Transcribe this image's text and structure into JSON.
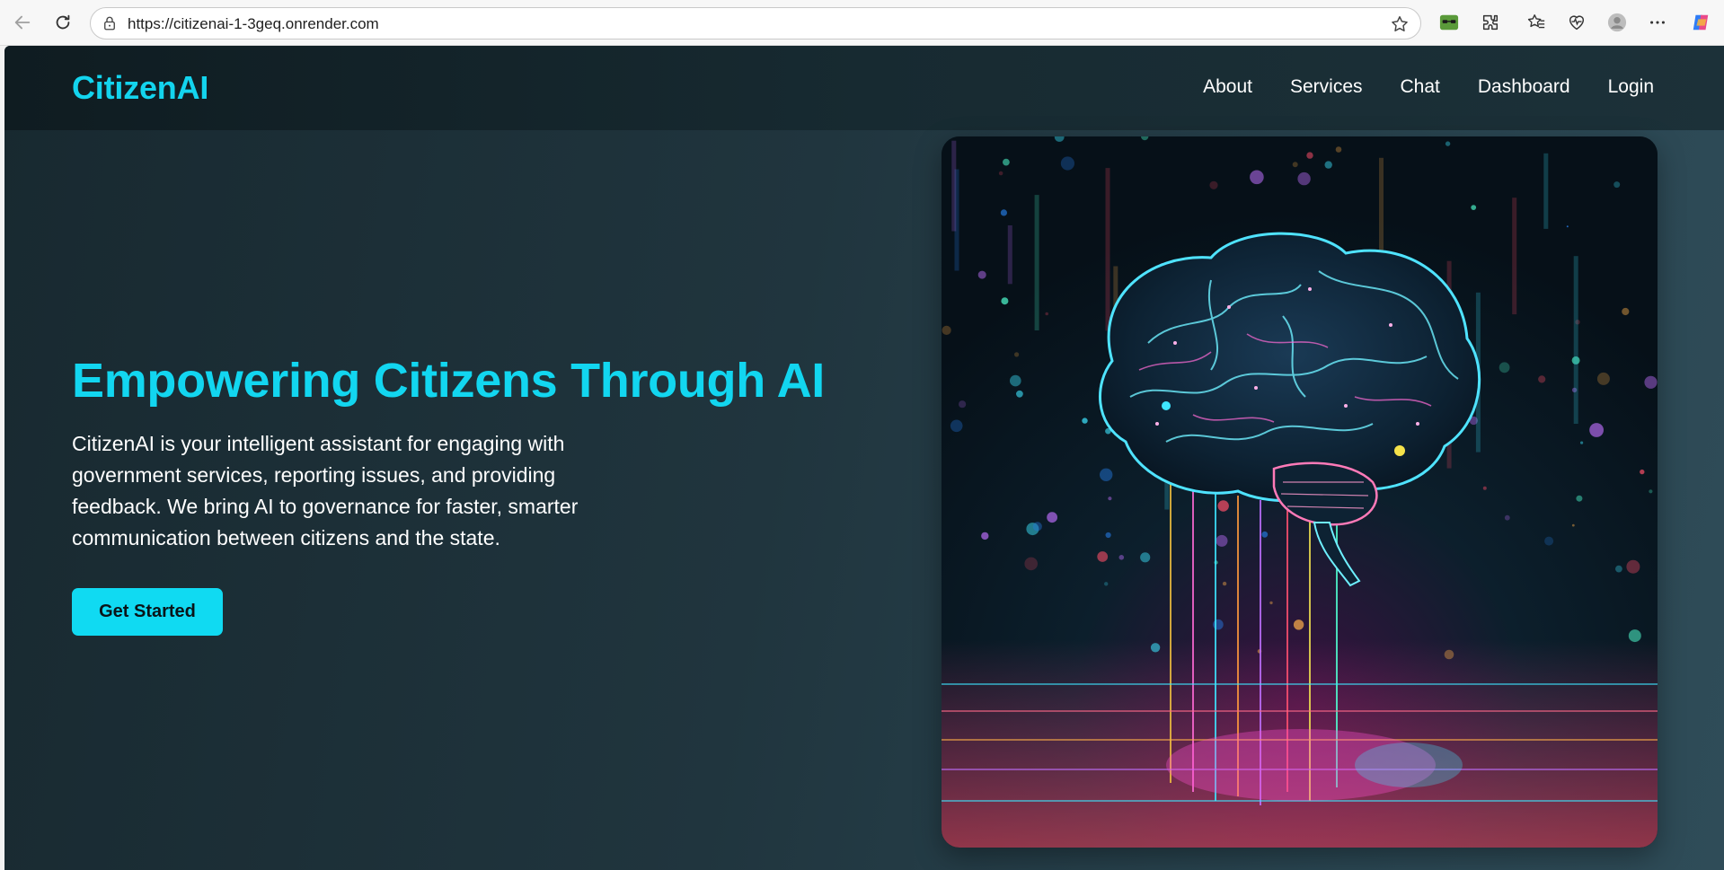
{
  "browser": {
    "url": "https://citizenai-1-3geq.onrender.com",
    "icons": [
      "back-icon",
      "reload-icon",
      "lock-icon",
      "star-icon",
      "glasses-extension-icon",
      "extensions-icon",
      "favorites-icon",
      "health-icon",
      "profile-icon",
      "more-icon",
      "copilot-icon"
    ]
  },
  "header": {
    "logo": "CitizenAI",
    "nav": [
      "About",
      "Services",
      "Chat",
      "Dashboard",
      "Login"
    ]
  },
  "hero": {
    "title": "Empowering Citizens Through AI",
    "description": "CitizenAI is your intelligent assistant for engaging with government services, reporting issues, and providing feedback. We bring AI to governance for faster, smarter communication between citizens and the state.",
    "cta_label": "Get Started",
    "image_icon": "ai-brain-illustration"
  },
  "colors": {
    "accent": "#12d6f0",
    "background_dark": "#182930",
    "header_dark": "#0f1c21",
    "text": "#ffffff"
  }
}
